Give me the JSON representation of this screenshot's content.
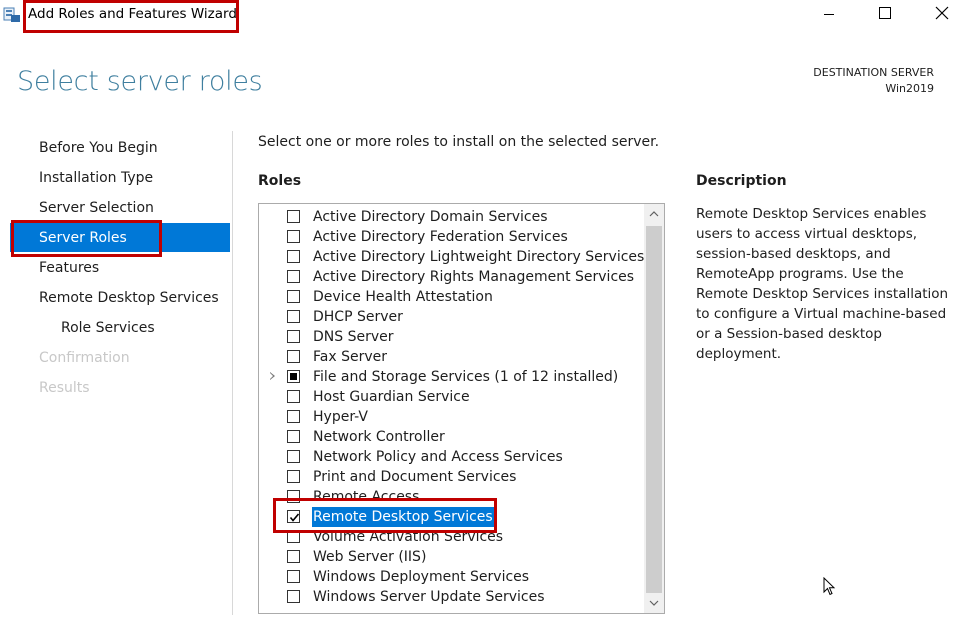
{
  "window": {
    "title": "Add Roles and Features Wizard",
    "controls": [
      "minimize",
      "maximize",
      "close"
    ]
  },
  "page": {
    "heading": "Select server roles",
    "destination_label": "DESTINATION SERVER",
    "destination_server": "Win2019"
  },
  "nav": {
    "items": [
      {
        "label": "Before You Begin",
        "state": "normal"
      },
      {
        "label": "Installation Type",
        "state": "normal"
      },
      {
        "label": "Server Selection",
        "state": "normal"
      },
      {
        "label": "Server Roles",
        "state": "selected"
      },
      {
        "label": "Features",
        "state": "normal"
      },
      {
        "label": "Remote Desktop Services",
        "state": "normal"
      },
      {
        "label": "Role Services",
        "state": "sub"
      },
      {
        "label": "Confirmation",
        "state": "disabled"
      },
      {
        "label": "Results",
        "state": "disabled"
      }
    ]
  },
  "main": {
    "instruction": "Select one or more roles to install on the selected server.",
    "roles_heading": "Roles",
    "roles": [
      {
        "label": "Active Directory Domain Services",
        "checked": false
      },
      {
        "label": "Active Directory Federation Services",
        "checked": false
      },
      {
        "label": "Active Directory Lightweight Directory Services",
        "checked": false
      },
      {
        "label": "Active Directory Rights Management Services",
        "checked": false
      },
      {
        "label": "Device Health Attestation",
        "checked": false
      },
      {
        "label": "DHCP Server",
        "checked": false
      },
      {
        "label": "DNS Server",
        "checked": false
      },
      {
        "label": "Fax Server",
        "checked": false
      },
      {
        "label": "File and Storage Services (1 of 12 installed)",
        "checked": "partial",
        "expandable": true
      },
      {
        "label": "Host Guardian Service",
        "checked": false
      },
      {
        "label": "Hyper-V",
        "checked": false
      },
      {
        "label": "Network Controller",
        "checked": false
      },
      {
        "label": "Network Policy and Access Services",
        "checked": false
      },
      {
        "label": "Print and Document Services",
        "checked": false
      },
      {
        "label": "Remote Access",
        "checked": false
      },
      {
        "label": "Remote Desktop Services",
        "checked": true,
        "selected": true
      },
      {
        "label": "Volume Activation Services",
        "checked": false
      },
      {
        "label": "Web Server (IIS)",
        "checked": false
      },
      {
        "label": "Windows Deployment Services",
        "checked": false
      },
      {
        "label": "Windows Server Update Services",
        "checked": false
      }
    ],
    "description_heading": "Description",
    "description_text": "Remote Desktop Services enables users to access virtual desktops, session-based desktops, and RemoteApp programs. Use the Remote Desktop Services installation to configure a Virtual machine-based or a Session-based desktop deployment."
  },
  "colors": {
    "heading": "#3f7f9f",
    "selection": "#0078d7",
    "annotation": "#c00000",
    "disabled_text": "#c8c8c8"
  }
}
